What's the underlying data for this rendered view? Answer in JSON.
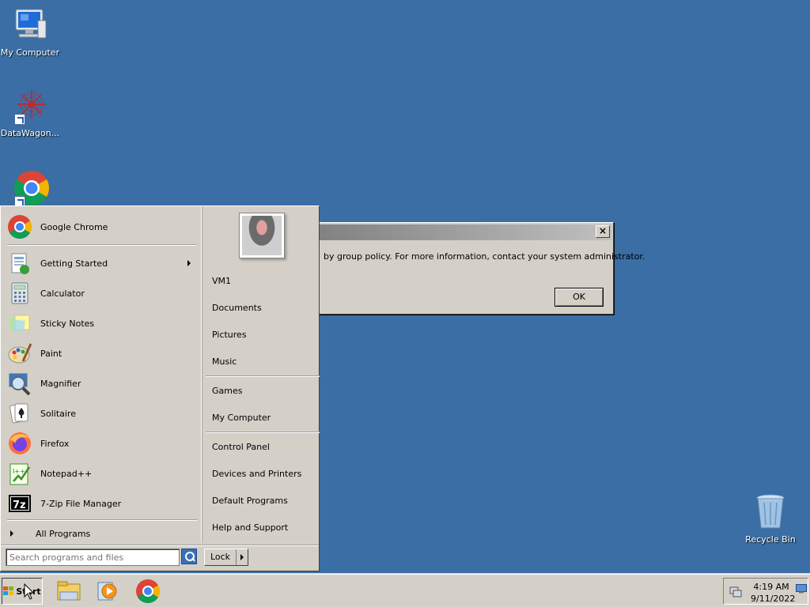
{
  "desktop": {
    "icons": [
      {
        "label": "My Computer"
      },
      {
        "label": "DataWagon..."
      },
      {
        "label": "Recycle Bin"
      }
    ]
  },
  "dialog": {
    "message": "by group policy. For more information, contact your system administrator.",
    "ok_label": "OK",
    "close_label": "×"
  },
  "start_menu": {
    "pinned": [
      {
        "label": "Google Chrome"
      }
    ],
    "recent": [
      {
        "label": "Getting Started",
        "has_submenu": true
      },
      {
        "label": "Calculator"
      },
      {
        "label": "Sticky Notes"
      },
      {
        "label": "Paint"
      },
      {
        "label": "Magnifier"
      },
      {
        "label": "Solitaire"
      },
      {
        "label": "Firefox"
      },
      {
        "label": "Notepad++"
      },
      {
        "label": "7-Zip File Manager"
      }
    ],
    "all_programs_label": "All Programs",
    "seven_zip_badge": "7z",
    "notepad_badge": "I++",
    "right": [
      {
        "label": "VM1"
      },
      {
        "label": "Documents"
      },
      {
        "label": "Pictures"
      },
      {
        "label": "Music"
      },
      {
        "label": "Games"
      },
      {
        "label": "My Computer"
      },
      {
        "label": "Control Panel"
      },
      {
        "label": "Devices and Printers"
      },
      {
        "label": "Default Programs"
      },
      {
        "label": "Help and Support"
      }
    ],
    "search": {
      "value": "",
      "placeholder": "Search programs and files"
    },
    "lock_label": "Lock"
  },
  "taskbar": {
    "start_label": "Start",
    "time": "4:19 AM",
    "date": "9/11/2022"
  },
  "colors": {
    "desktop_bg": "#3a6ea5",
    "chrome_red": "#db4437",
    "chrome_yellow": "#f4b400",
    "chrome_green": "#0f9d58",
    "chrome_blue": "#4285f4"
  }
}
